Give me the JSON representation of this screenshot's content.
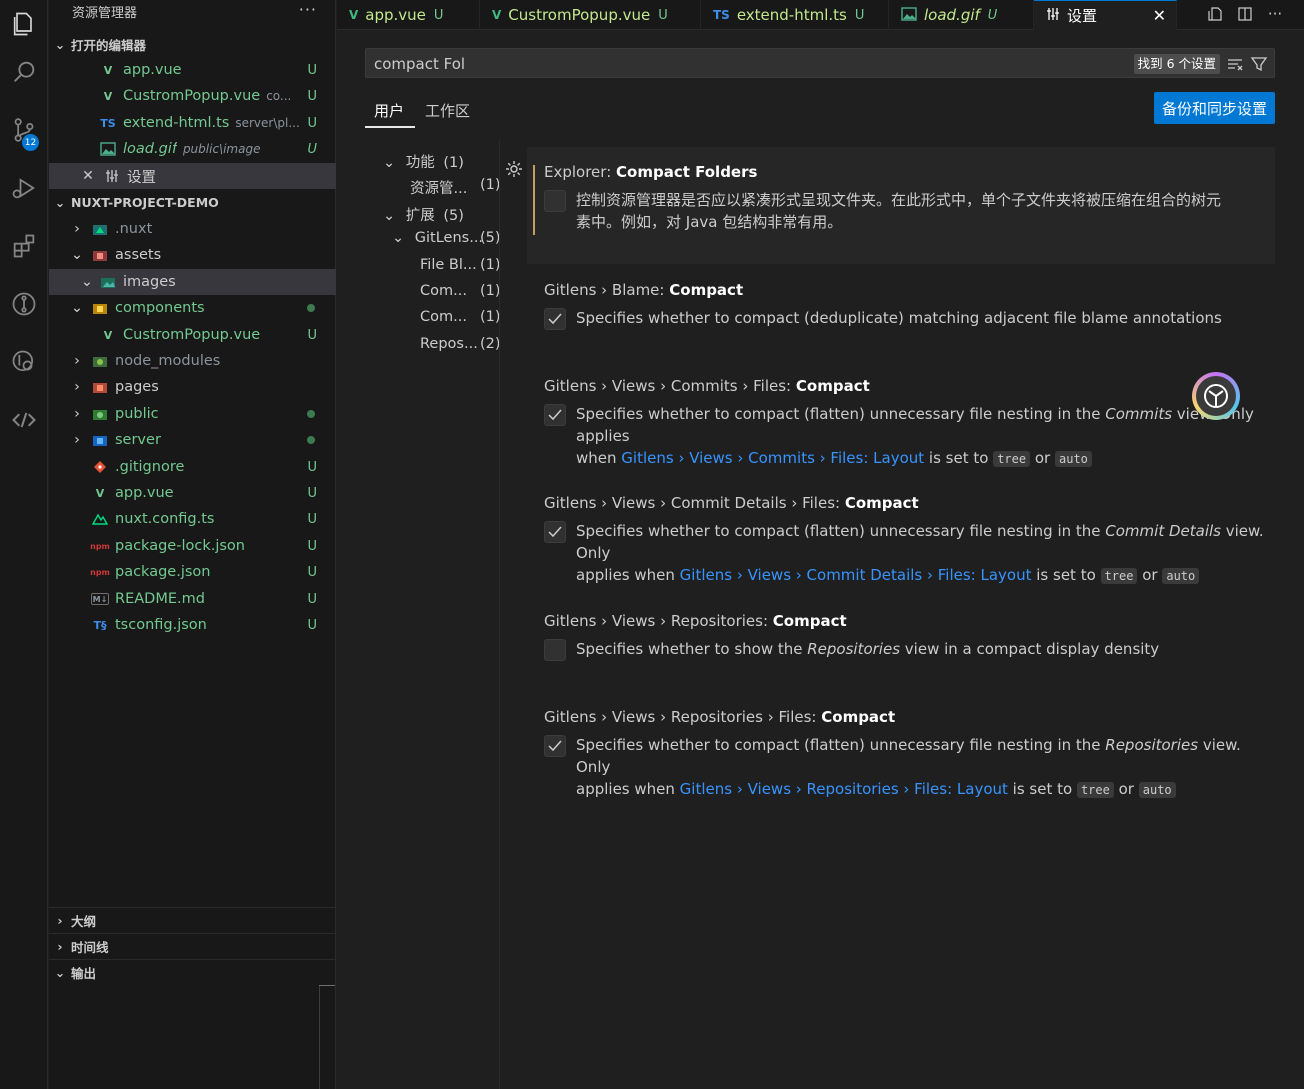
{
  "explorer": {
    "title": "资源管理器",
    "more": "···",
    "open_editors_header": "打开的编辑器",
    "open_editors": [
      {
        "label": "app.vue",
        "desc": "",
        "status": "U"
      },
      {
        "label": "CustromPopup.vue",
        "desc": "co...",
        "status": "U"
      },
      {
        "label": "extend-html.ts",
        "desc": "server\\pl...",
        "status": "U"
      },
      {
        "label": "load.gif",
        "desc": "public\\image",
        "status": "U"
      },
      {
        "label": "设置",
        "desc": "",
        "status": ""
      }
    ],
    "project_header": "NUXT-PROJECT-DEMO",
    "tree": [
      {
        "label": ".nuxt",
        "status": ""
      },
      {
        "label": "assets",
        "status": ""
      },
      {
        "label": "images",
        "status": ""
      },
      {
        "label": "components",
        "status": ""
      },
      {
        "label": "CustromPopup.vue",
        "status": "U"
      },
      {
        "label": "node_modules",
        "status": ""
      },
      {
        "label": "pages",
        "status": ""
      },
      {
        "label": "public",
        "status": ""
      },
      {
        "label": "server",
        "status": ""
      },
      {
        "label": ".gitignore",
        "status": "U"
      },
      {
        "label": "app.vue",
        "status": "U"
      },
      {
        "label": "nuxt.config.ts",
        "status": "U"
      },
      {
        "label": "package-lock.json",
        "status": "U"
      },
      {
        "label": "package.json",
        "status": "U"
      },
      {
        "label": "README.md",
        "status": "U"
      },
      {
        "label": "tsconfig.json",
        "status": "U"
      }
    ],
    "outline_header": "大纲",
    "timeline_header": "时间线",
    "output_header": "输出"
  },
  "activity_badge": "12",
  "tabs": [
    {
      "label": "app.vue",
      "icon": "V",
      "status": "U"
    },
    {
      "label": "CustromPopup.vue",
      "icon": "V",
      "status": "U"
    },
    {
      "label": "extend-html.ts",
      "icon": "TS",
      "status": "U"
    },
    {
      "label": "load.gif",
      "icon": "img",
      "status": "U"
    },
    {
      "label": "设置",
      "icon": "settings",
      "status": ""
    }
  ],
  "settings": {
    "search_value": "compact Fol",
    "search_count": "找到 6 个设置",
    "scope_tabs": [
      "用户",
      "工作区"
    ],
    "sync_button": "备份和同步设置",
    "toc": [
      {
        "label": "功能",
        "count": "(1)"
      },
      {
        "label": "资源管...",
        "count": "(1)"
      },
      {
        "label": "扩展",
        "count": "(5)"
      },
      {
        "label": "GitLens...",
        "count": "(5)"
      },
      {
        "label": "File Bl...",
        "count": "(1)"
      },
      {
        "label": "Com...",
        "count": "(1)"
      },
      {
        "label": "Com...",
        "count": "(1)"
      },
      {
        "label": "Repos...",
        "count": "(2)"
      }
    ],
    "items": [
      {
        "category": "Explorer: ",
        "name": "Compact Folders",
        "checked": false,
        "desc_line1": "控制资源管理器是否应以紧凑形式呈现文件夹。在此形式中，单个子文件夹将被压缩在组合的树元",
        "desc_line2": "素中。例如，对 Java 包结构非常有用。"
      },
      {
        "category": "Gitlens › Blame: ",
        "name": "Compact",
        "checked": true,
        "desc_line1": "Specifies whether to compact (deduplicate) matching adjacent file blame annotations"
      },
      {
        "category": "Gitlens › Views › Commits › Files: ",
        "name": "Compact",
        "checked": true,
        "desc_pre": "Specifies whether to compact (flatten) unnecessary file nesting in the ",
        "desc_em": "Commits",
        "desc_post": " view. Only applies",
        "l2_pre": "when ",
        "l2_link": "Gitlens › Views › Commits › Files: Layout",
        "l2_mid": " is set to ",
        "code1": "tree",
        "or": " or ",
        "code2": "auto"
      },
      {
        "category": "Gitlens › Views › Commit Details › Files: ",
        "name": "Compact",
        "checked": true,
        "desc_pre": "Specifies whether to compact (flatten) unnecessary file nesting in the ",
        "desc_em": "Commit Details",
        "desc_post": " view. Only",
        "l2_pre": "applies when ",
        "l2_link": "Gitlens › Views › Commit Details › Files: Layout",
        "l2_mid": " is set to ",
        "code1": "tree",
        "or": " or ",
        "code2": "auto"
      },
      {
        "category": "Gitlens › Views › Repositories: ",
        "name": "Compact",
        "checked": false,
        "desc_pre": "Specifies whether to show the ",
        "desc_em": "Repositories",
        "desc_post": " view in a compact display density"
      },
      {
        "category": "Gitlens › Views › Repositories › Files: ",
        "name": "Compact",
        "checked": true,
        "desc_pre": "Specifies whether to compact (flatten) unnecessary file nesting in the ",
        "desc_em": "Repositories",
        "desc_post": " view. Only",
        "l2_pre": "applies when ",
        "l2_link": "Gitlens › Views › Repositories › Files: Layout",
        "l2_mid": " is set to ",
        "code1": "tree",
        "or": " or ",
        "code2": "auto"
      }
    ]
  },
  "colors": {
    "accent": "#0078d4",
    "git_untracked": "#73c991",
    "link": "#3794ff"
  }
}
